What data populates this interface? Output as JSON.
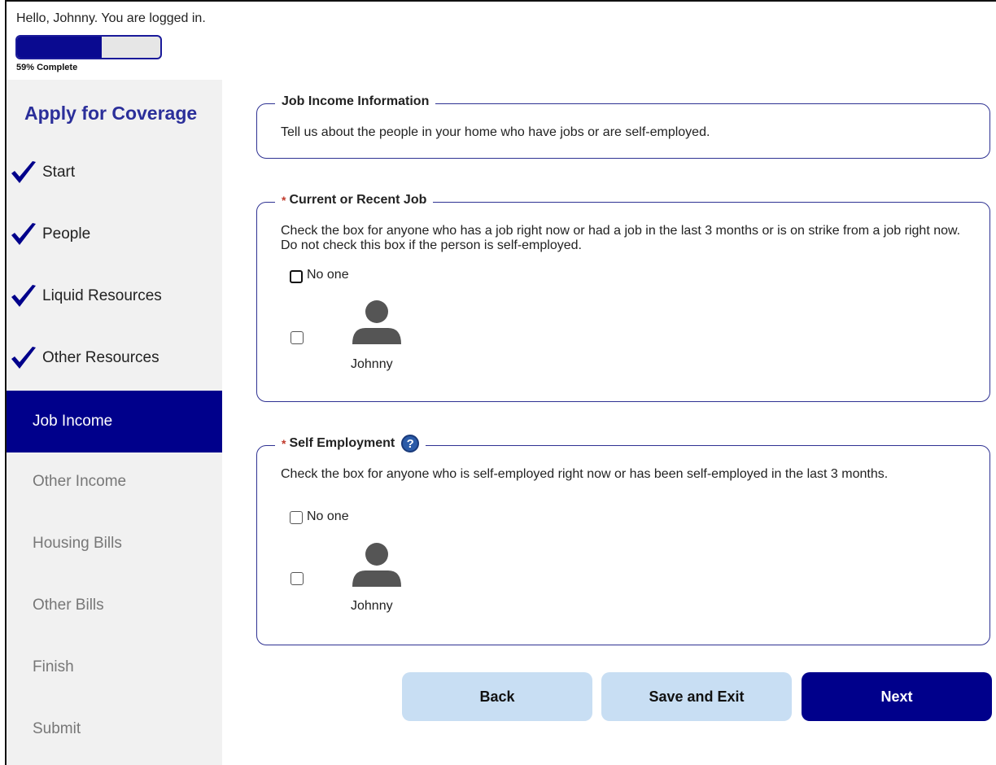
{
  "header": {
    "greeting": "Hello, Johnny. You are logged in.",
    "progress_percent": 59,
    "progress_label": "59% Complete"
  },
  "sidebar": {
    "title": "Apply for Coverage",
    "items": [
      {
        "label": "Start",
        "status": "done"
      },
      {
        "label": "People",
        "status": "done"
      },
      {
        "label": "Liquid Resources",
        "status": "done"
      },
      {
        "label": "Other Resources",
        "status": "done"
      },
      {
        "label": "Job Income",
        "status": "active"
      },
      {
        "label": "Other Income",
        "status": "pending"
      },
      {
        "label": "Housing Bills",
        "status": "pending"
      },
      {
        "label": "Other Bills",
        "status": "pending"
      },
      {
        "label": "Finish",
        "status": "pending"
      },
      {
        "label": "Submit",
        "status": "pending"
      }
    ]
  },
  "job_income_info": {
    "legend": "Job Income Information",
    "description": "Tell us about the people in your home who have jobs or are self-employed."
  },
  "current_job": {
    "required_mark": "*",
    "legend": "Current or Recent Job",
    "description": "Check the box for anyone who has a job right now or had a job in the last 3 months or is on strike from a job right now. Do not check this box if the person is self-employed.",
    "no_one_label": "No one",
    "person_name": "Johnny"
  },
  "self_employment": {
    "required_mark": "*",
    "legend": "Self Employment",
    "help_glyph": "?",
    "description": "Check the box for anyone who is self-employed right now or has been self-employed in the last 3 months.",
    "no_one_label": "No one",
    "person_name": "Johnny"
  },
  "buttons": {
    "back": "Back",
    "save_exit": "Save and Exit",
    "next": "Next"
  },
  "colors": {
    "primary": "#00008b",
    "light_button": "#c8def3",
    "sidebar_bg": "#f1f1f1",
    "title": "#2b2f9a"
  }
}
